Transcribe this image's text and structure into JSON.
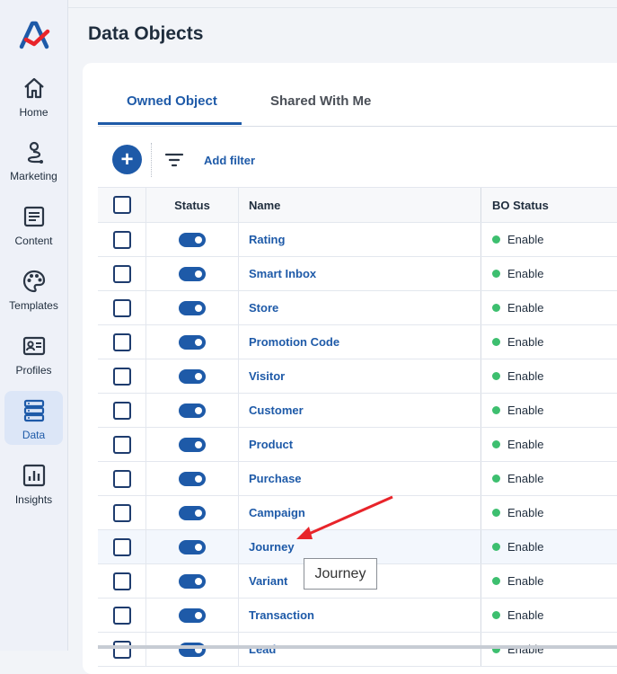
{
  "sidebar": {
    "items": [
      {
        "label": "Home",
        "icon": "home-icon"
      },
      {
        "label": "Marketing",
        "icon": "route-icon"
      },
      {
        "label": "Content",
        "icon": "document-icon"
      },
      {
        "label": "Templates",
        "icon": "palette-icon"
      },
      {
        "label": "Profiles",
        "icon": "id-card-icon"
      },
      {
        "label": "Data",
        "icon": "database-icon"
      },
      {
        "label": "Insights",
        "icon": "bar-chart-icon"
      }
    ],
    "active": "Data"
  },
  "page": {
    "title": "Data Objects"
  },
  "tabs": [
    {
      "label": "Owned Object",
      "active": true
    },
    {
      "label": "Shared With Me",
      "active": false
    }
  ],
  "toolbar": {
    "add_label": "+",
    "add_filter_label": "Add filter"
  },
  "table": {
    "headers": {
      "status": "Status",
      "name": "Name",
      "bo_status": "BO Status"
    },
    "rows": [
      {
        "name": "Rating",
        "bo_status": "Enable",
        "enabled": true
      },
      {
        "name": "Smart Inbox",
        "bo_status": "Enable",
        "enabled": true
      },
      {
        "name": "Store",
        "bo_status": "Enable",
        "enabled": true
      },
      {
        "name": "Promotion Code",
        "bo_status": "Enable",
        "enabled": true
      },
      {
        "name": "Visitor",
        "bo_status": "Enable",
        "enabled": true
      },
      {
        "name": "Customer",
        "bo_status": "Enable",
        "enabled": true
      },
      {
        "name": "Product",
        "bo_status": "Enable",
        "enabled": true
      },
      {
        "name": "Purchase",
        "bo_status": "Enable",
        "enabled": true
      },
      {
        "name": "Campaign",
        "bo_status": "Enable",
        "enabled": true
      },
      {
        "name": "Journey",
        "bo_status": "Enable",
        "enabled": true
      },
      {
        "name": "Variant",
        "bo_status": "Enable",
        "enabled": true
      },
      {
        "name": "Transaction",
        "bo_status": "Enable",
        "enabled": true
      },
      {
        "name": "Lead",
        "bo_status": "Enable",
        "enabled": true
      }
    ]
  },
  "tooltip": {
    "text": "Journey"
  },
  "colors": {
    "accent": "#1e5aa8",
    "status_green": "#3dbf6f",
    "annotation_red": "#e8242a"
  }
}
